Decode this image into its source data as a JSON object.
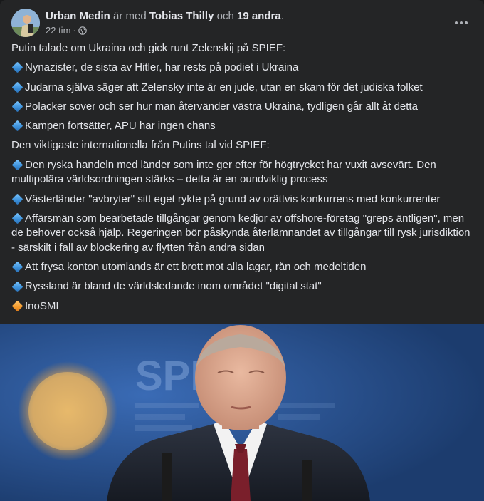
{
  "post": {
    "author": "Urban Medin",
    "with_text": "är med",
    "tagged": "Tobias Thilly",
    "and_text": "och",
    "others": "19 andra",
    "period": ".",
    "time": "22 tim",
    "separator": "·",
    "privacy_icon": "globe-icon",
    "menu_icon": "more-horizontal-icon"
  },
  "content": {
    "intro": "Putin talade om Ukraina och gick runt Zelenskij på SPIEF:",
    "bullets1": [
      "Nynazister, de sista av Hitler, har rests på podiet i Ukraina",
      "Judarna själva säger att Zelensky inte är en jude, utan en skam för det judiska folket",
      "Polacker sover och ser hur man återvänder västra Ukraina, tydligen går allt åt detta",
      "Kampen fortsätter, APU har ingen chans"
    ],
    "heading2": "Den viktigaste internationella från Putins tal vid SPIEF:",
    "bullets2": [
      "Den ryska handeln med länder som inte ger efter för högtrycket har vuxit avsevärt. Den multipolära världsordningen stärks – detta är en oundviklig process",
      "Västerländer \"avbryter\" sitt eget rykte på grund av orättvis konkurrens med konkurrenter",
      "Affärsmän som bearbetade tillgångar genom kedjor av offshore-företag \"greps äntligen\", men de behöver också hjälp. Regeringen bör påskynda återlämnandet av tillgångar till rysk jurisdiktion - särskilt i fall av blockering av flytten från andra sidan",
      "Att frysa konton utomlands är ett brott mot alla lagar, rån och medeltiden",
      "Ryssland är bland de världsledande inom området \"digital stat\""
    ],
    "source": "InoSMI"
  },
  "icons": {
    "blue_bullet": "small-blue-diamond-icon",
    "orange_bullet": "small-orange-diamond-icon"
  },
  "colors": {
    "card_bg": "#242526",
    "text": "#e4e6eb",
    "muted": "#b0b3b8",
    "photo_bg": "#22487f"
  }
}
